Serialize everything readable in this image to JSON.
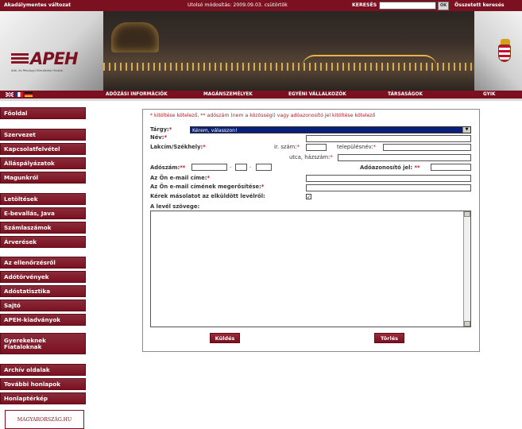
{
  "topbar": {
    "title": "Akadálymentes változat",
    "updated": "Utolsó módosítás: 2009.09.03. csütörtök",
    "search_label": "KERESÉS",
    "search_value": "",
    "ok_label": "OK",
    "advanced_search": "Összetett keresés"
  },
  "brand": {
    "logo_text": "APEH",
    "logo_subtitle": "Adó- és Pénzügyi Ellenőrzési Hivatal"
  },
  "nav": {
    "items": [
      "ADÓZÁSI INFORMÁCIÓK",
      "MAGÁNSZEMÉLYEK",
      "EGYÉNI VÁLLALKOZÓK",
      "TÁRSASÁGOK",
      "GYIK"
    ]
  },
  "sidebar": {
    "items": [
      "Főoldal",
      "Szervezet",
      "Kapcsolatfelvétel",
      "Álláspályázatok",
      "Magunkról",
      "Letöltések",
      "E-bevallás, Java",
      "Számlaszámok",
      "Árverések",
      "Az ellenőrzésről",
      "Adótörvények",
      "Adóstatisztika",
      "Sajtó",
      "APEH-kiadványok",
      "Gyerekeknek Fiataloknak",
      "Archív oldalak",
      "További honlapok",
      "Honlaptérkép"
    ],
    "badge": "MAGYARORSZÁG.HU"
  },
  "form": {
    "note": "* kitöltése kötelező,  ** adószám (nem a közösségi) vagy adóazonosító jel kitöltése kötelező",
    "subject_label": "Tárgy:",
    "subject_value": "Kérem, válasszon!",
    "name_label": "Név:",
    "address_label": "Lakcím/Székhely:",
    "zip_label": "ir. szám:",
    "city_label": "településnév:",
    "street_label": "utca, házszám:",
    "tax_number_label": "Adószám:",
    "tax_id_label": "Adóazonosító jel:",
    "email_label": "Az Ön e-mail címe:",
    "email_confirm_label": "Az Ön e-mail címének megerősítése:",
    "copy_label": "Kérek másolatot az elküldött levélről:",
    "message_label": "A levél szövege:",
    "send_label": "Küldés",
    "clear_label": "Törlés",
    "star": "*",
    "double_star": "**",
    "copy_checked": true
  },
  "colors": {
    "brand": "#7b1020",
    "note": "#b11a26",
    "select_bg": "#0a1f7a"
  }
}
